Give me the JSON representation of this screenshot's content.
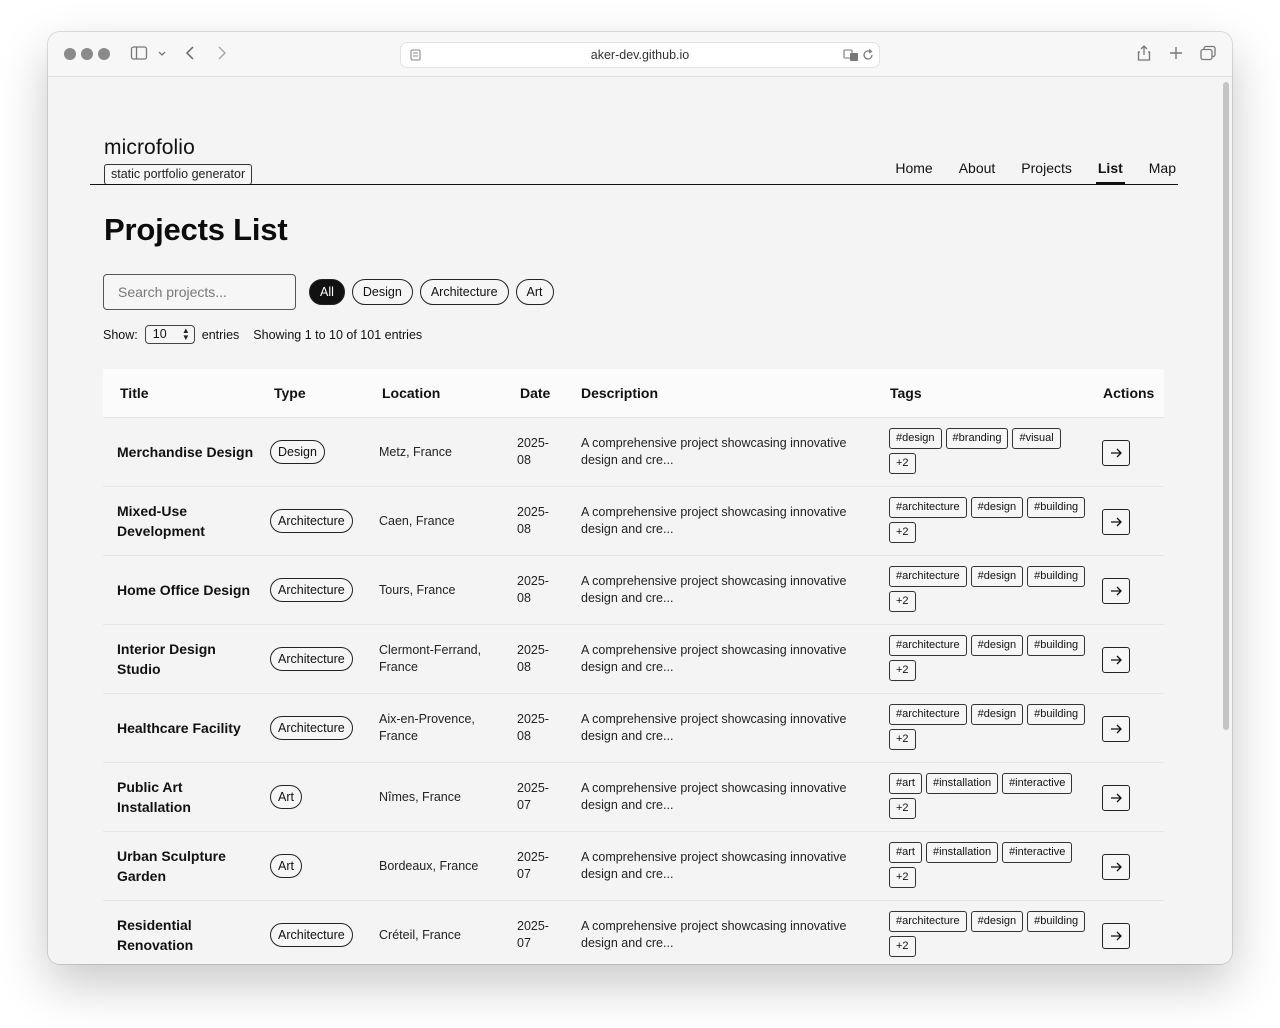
{
  "browser": {
    "url": "aker-dev.github.io"
  },
  "site": {
    "name": "microfolio",
    "tagline": "static portfolio generator"
  },
  "nav": [
    {
      "label": "Home",
      "active": false
    },
    {
      "label": "About",
      "active": false
    },
    {
      "label": "Projects",
      "active": false
    },
    {
      "label": "List",
      "active": true
    },
    {
      "label": "Map",
      "active": false
    }
  ],
  "page": {
    "title": "Projects List"
  },
  "search": {
    "placeholder": "Search projects...",
    "value": ""
  },
  "filters": [
    {
      "label": "All",
      "active": true
    },
    {
      "label": "Design",
      "active": false
    },
    {
      "label": "Architecture",
      "active": false
    },
    {
      "label": "Art",
      "active": false
    }
  ],
  "pagination": {
    "show_label": "Show:",
    "page_size": "10",
    "entries_label": "entries",
    "info": "Showing 1 to 10 of 101 entries"
  },
  "table": {
    "columns": [
      "Title",
      "Type",
      "Location",
      "Date",
      "Description",
      "Tags",
      "Actions"
    ],
    "rows": [
      {
        "title": "Merchandise Design",
        "type": "Design",
        "location": "Metz, France",
        "date": "2025-08",
        "description": "A comprehensive project showcasing innovative design and cre...",
        "tags": [
          "#design",
          "#branding",
          "#visual",
          "+2"
        ]
      },
      {
        "title": "Mixed-Use Development",
        "type": "Architecture",
        "location": "Caen, France",
        "date": "2025-08",
        "description": "A comprehensive project showcasing innovative design and cre...",
        "tags": [
          "#architecture",
          "#design",
          "#building",
          "+2"
        ]
      },
      {
        "title": "Home Office Design",
        "type": "Architecture",
        "location": "Tours, France",
        "date": "2025-08",
        "description": "A comprehensive project showcasing innovative design and cre...",
        "tags": [
          "#architecture",
          "#design",
          "#building",
          "+2"
        ]
      },
      {
        "title": "Interior Design Studio",
        "type": "Architecture",
        "location": "Clermont-Ferrand, France",
        "date": "2025-08",
        "description": "A comprehensive project showcasing innovative design and cre...",
        "tags": [
          "#architecture",
          "#design",
          "#building",
          "+2"
        ]
      },
      {
        "title": "Healthcare Facility",
        "type": "Architecture",
        "location": "Aix-en-Provence, France",
        "date": "2025-08",
        "description": "A comprehensive project showcasing innovative design and cre...",
        "tags": [
          "#architecture",
          "#design",
          "#building",
          "+2"
        ]
      },
      {
        "title": "Public Art Installation",
        "type": "Art",
        "location": "Nîmes, France",
        "date": "2025-07",
        "description": "A comprehensive project showcasing innovative design and cre...",
        "tags": [
          "#art",
          "#installation",
          "#interactive",
          "+2"
        ]
      },
      {
        "title": "Urban Sculpture Garden",
        "type": "Art",
        "location": "Bordeaux, France",
        "date": "2025-07",
        "description": "A comprehensive project showcasing innovative design and cre...",
        "tags": [
          "#art",
          "#installation",
          "#interactive",
          "+2"
        ]
      },
      {
        "title": "Residential Renovation",
        "type": "Architecture",
        "location": "Créteil, France",
        "date": "2025-07",
        "description": "A comprehensive project showcasing innovative design and cre...",
        "tags": [
          "#architecture",
          "#design",
          "#building",
          "+2"
        ]
      }
    ]
  },
  "icons": {
    "sidebar": "sidebar-icon",
    "back": "chevron-left-icon",
    "forward": "chevron-right-icon",
    "translate": "translate-icon",
    "reload": "reload-icon",
    "share": "share-icon",
    "new_tab": "plus-icon",
    "tabs": "tabs-overview-icon",
    "row_action": "arrow-right-icon"
  }
}
